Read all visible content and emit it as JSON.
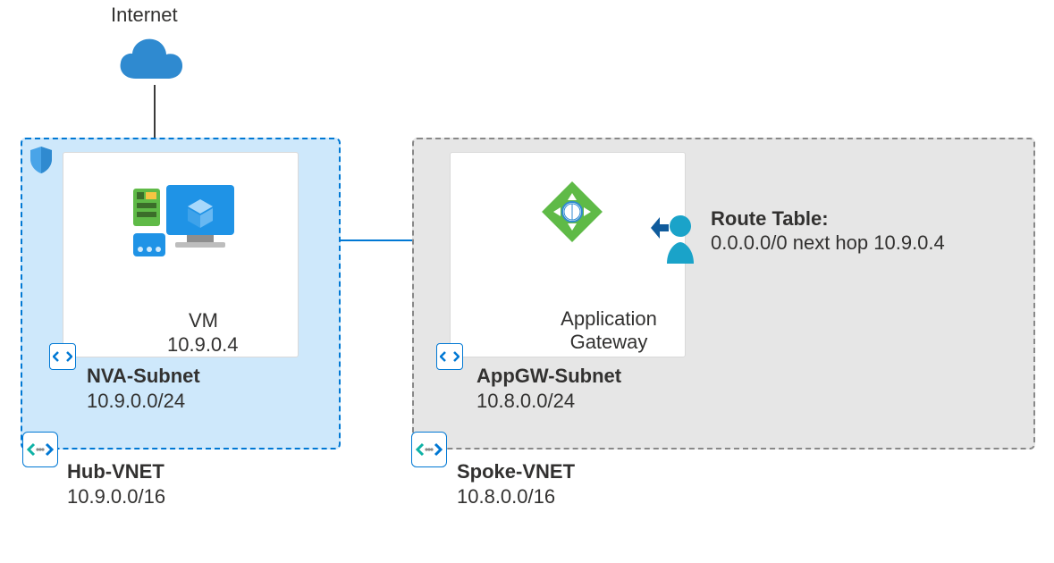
{
  "internet_label": "Internet",
  "hub": {
    "vnet_name": "Hub-VNET",
    "vnet_cidr": "10.9.0.0/16",
    "subnet_name": "NVA-Subnet",
    "subnet_cidr": "10.9.0.0/24",
    "vm_label": "VM",
    "vm_ip": "10.9.0.4"
  },
  "spoke": {
    "vnet_name": "Spoke-VNET",
    "vnet_cidr": "10.8.0.0/16",
    "subnet_name": "AppGW-Subnet",
    "subnet_cidr": "10.8.0.0/24",
    "appgw_label": "Application Gateway",
    "route_title": "Route Table:",
    "route_text": "0.0.0.0/0 next hop 10.9.0.4"
  }
}
